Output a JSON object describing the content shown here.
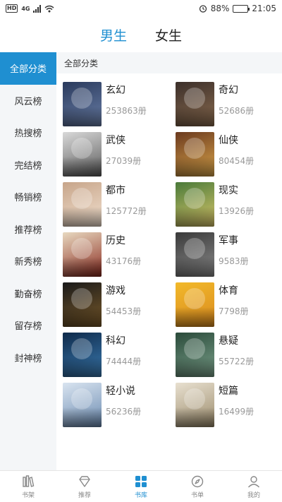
{
  "status": {
    "left_badge": "HD",
    "network": "4G",
    "battery_pct": 88,
    "battery_text": "88%",
    "time": "21:05"
  },
  "gender_tabs": [
    {
      "label": "男生",
      "active": true
    },
    {
      "label": "女生",
      "active": false
    }
  ],
  "sidebar": {
    "items": [
      {
        "label": "全部分类",
        "active": true
      },
      {
        "label": "风云榜"
      },
      {
        "label": "热搜榜"
      },
      {
        "label": "完结榜"
      },
      {
        "label": "畅销榜"
      },
      {
        "label": "推荐榜"
      },
      {
        "label": "新秀榜"
      },
      {
        "label": "勤奋榜"
      },
      {
        "label": "留存榜"
      },
      {
        "label": "封神榜"
      }
    ]
  },
  "main": {
    "section_title": "全部分类",
    "categories": [
      {
        "name": "玄幻",
        "count": "253863册",
        "c1": "#2a3a5c",
        "c2": "#6a7fa8"
      },
      {
        "name": "奇幻",
        "count": "52686册",
        "c1": "#3b2f2a",
        "c2": "#8a6b4f"
      },
      {
        "name": "武侠",
        "count": "27039册",
        "c1": "#d9d9d9",
        "c2": "#5a5a5a"
      },
      {
        "name": "仙侠",
        "count": "80454册",
        "c1": "#6b3a1f",
        "c2": "#d9a44a"
      },
      {
        "name": "都市",
        "count": "125772册",
        "c1": "#c7a58a",
        "c2": "#f2e1d0"
      },
      {
        "name": "现实",
        "count": "13926册",
        "c1": "#4a7a3a",
        "c2": "#d9c66a"
      },
      {
        "name": "历史",
        "count": "43176册",
        "c1": "#e8d9c0",
        "c2": "#8a2a1f"
      },
      {
        "name": "军事",
        "count": "9583册",
        "c1": "#3a3a3a",
        "c2": "#8a8a8a"
      },
      {
        "name": "游戏",
        "count": "54453册",
        "c1": "#1a1a1a",
        "c2": "#7a5a2a"
      },
      {
        "name": "体育",
        "count": "7798册",
        "c1": "#f2b92a",
        "c2": "#d98a1f"
      },
      {
        "name": "科幻",
        "count": "74444册",
        "c1": "#0f2a4a",
        "c2": "#3a7ab0"
      },
      {
        "name": "悬疑",
        "count": "55722册",
        "c1": "#2a4a3a",
        "c2": "#7aa08a"
      },
      {
        "name": "轻小说",
        "count": "56236册",
        "c1": "#d9e4f0",
        "c2": "#6a8ab0"
      },
      {
        "name": "短篇",
        "count": "16499册",
        "c1": "#e8e0d0",
        "c2": "#9a8a6a"
      }
    ]
  },
  "bottom_nav": [
    {
      "label": "书架",
      "icon": "bookshelf-icon"
    },
    {
      "label": "推荐",
      "icon": "diamond-icon"
    },
    {
      "label": "书库",
      "icon": "grid-icon",
      "active": true
    },
    {
      "label": "书单",
      "icon": "compass-icon"
    },
    {
      "label": "我的",
      "icon": "user-icon"
    }
  ],
  "colors": {
    "accent": "#1f8fd1",
    "sidebar_bg": "#f4f6f8",
    "muted_text": "#999999"
  }
}
